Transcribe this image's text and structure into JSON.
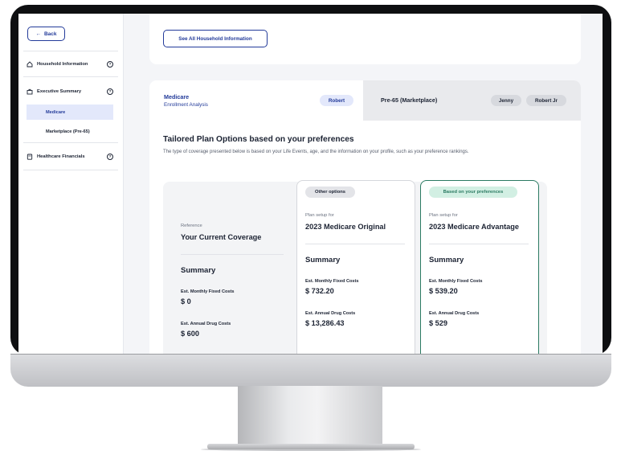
{
  "sidebar": {
    "back_label": "Back",
    "items": [
      {
        "label": "Household Information",
        "help": "?"
      },
      {
        "label": "Executive Summary",
        "help": "?"
      },
      {
        "label": "Healthcare Financials",
        "help": "?"
      }
    ],
    "sub_items": [
      {
        "label": "Medicare",
        "active": true
      },
      {
        "label": "Marketplace (Pre-65)",
        "active": false
      }
    ]
  },
  "top_card": {
    "see_all_label": "See All Household Information"
  },
  "tabs": {
    "left": {
      "title": "Medicare",
      "subtitle": "Enrollment Analysis",
      "person": "Robert"
    },
    "right": {
      "title": "Pre-65 (Marketplace)",
      "persons": [
        "Jenny",
        "Robert Jr"
      ]
    }
  },
  "main": {
    "headline": "Tailored Plan Options based on your preferences",
    "description": "The type of coverage presented below is based on your Life Events, age, and the information on your profile, such as your preference rankings."
  },
  "columns": [
    {
      "badge": "",
      "small_label": "Reference",
      "plan_name": "Your Current Coverage",
      "summary_label": "Summary",
      "monthly_label": "Est. Monthly Fixed Costs",
      "monthly_value": "$ 0",
      "annual_label": "Est. Annual Drug Costs",
      "annual_value": "$ 600"
    },
    {
      "badge": "Other options",
      "small_label": "Plan setup for",
      "plan_name": "2023 Medicare Original",
      "summary_label": "Summary",
      "monthly_label": "Est. Monthly Fixed Costs",
      "monthly_value": "$ 732.20",
      "annual_label": "Est. Annual Drug Costs",
      "annual_value": "$ 13,286.43"
    },
    {
      "badge": "Based on your preferences",
      "small_label": "Plan setup for",
      "plan_name": "2023 Medicare Advantage",
      "summary_label": "Summary",
      "monthly_label": "Est. Monthly Fixed Costs",
      "monthly_value": "$ 539.20",
      "annual_label": "Est. Annual Drug Costs",
      "annual_value": "$ 529"
    }
  ],
  "colors": {
    "primary": "#233b9a",
    "accent_green": "#2b7a62",
    "active_bg": "#e3e8fb",
    "screen_bg": "#f4f5f8"
  },
  "icons": [
    "arrow-left-icon",
    "home-icon",
    "briefcase-icon",
    "calculator-icon",
    "help-icon"
  ]
}
